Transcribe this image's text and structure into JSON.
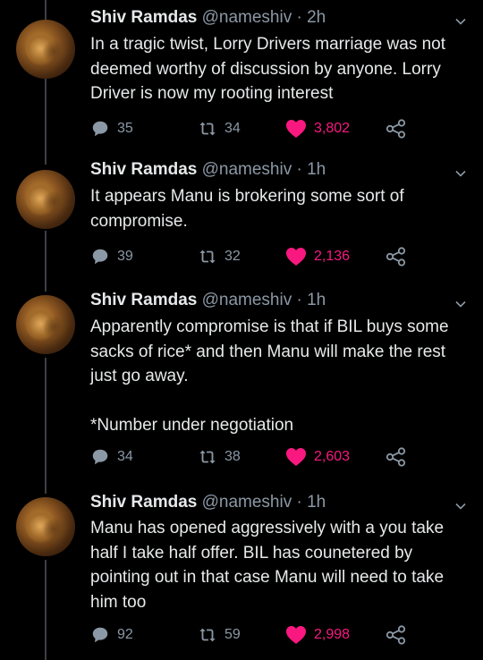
{
  "tweets": [
    {
      "name": "Shiv Ramdas",
      "handle": "@nameshiv",
      "separator": "·",
      "time": "2h",
      "text": [
        "In a tragic twist, Lorry Drivers marriage was not deemed worthy of discussion by anyone. Lorry Driver is now my rooting interest"
      ],
      "replies": "35",
      "retweets": "34",
      "likes": "3,802"
    },
    {
      "name": "Shiv Ramdas",
      "handle": "@nameshiv",
      "separator": "·",
      "time": "1h",
      "text": [
        "It appears Manu is brokering some sort of compromise."
      ],
      "replies": "39",
      "retweets": "32",
      "likes": "2,136"
    },
    {
      "name": "Shiv Ramdas",
      "handle": "@nameshiv",
      "separator": "·",
      "time": "1h",
      "text": [
        "Apparently compromise is that if BIL buys some sacks of rice* and then Manu will make the rest just go away.",
        "*Number under negotiation"
      ],
      "replies": "34",
      "retweets": "38",
      "likes": "2,603"
    },
    {
      "name": "Shiv Ramdas",
      "handle": "@nameshiv",
      "separator": "·",
      "time": "1h",
      "text": [
        "Manu has opened aggressively with a you take half I take half offer. BIL has counetered by pointing out in that case Manu will need to take him too"
      ],
      "replies": "92",
      "retweets": "59",
      "likes": "2,998"
    }
  ],
  "colors": {
    "background": "#000000",
    "text": "#e7e9ea",
    "muted": "#8b98a5",
    "like": "#f91880",
    "thread_line": "#3a3f44"
  },
  "icons": {
    "reply": "reply-bubble-icon",
    "retweet": "retweet-icon",
    "like": "heart-icon",
    "share": "share-icon",
    "more": "chevron-down-icon"
  }
}
